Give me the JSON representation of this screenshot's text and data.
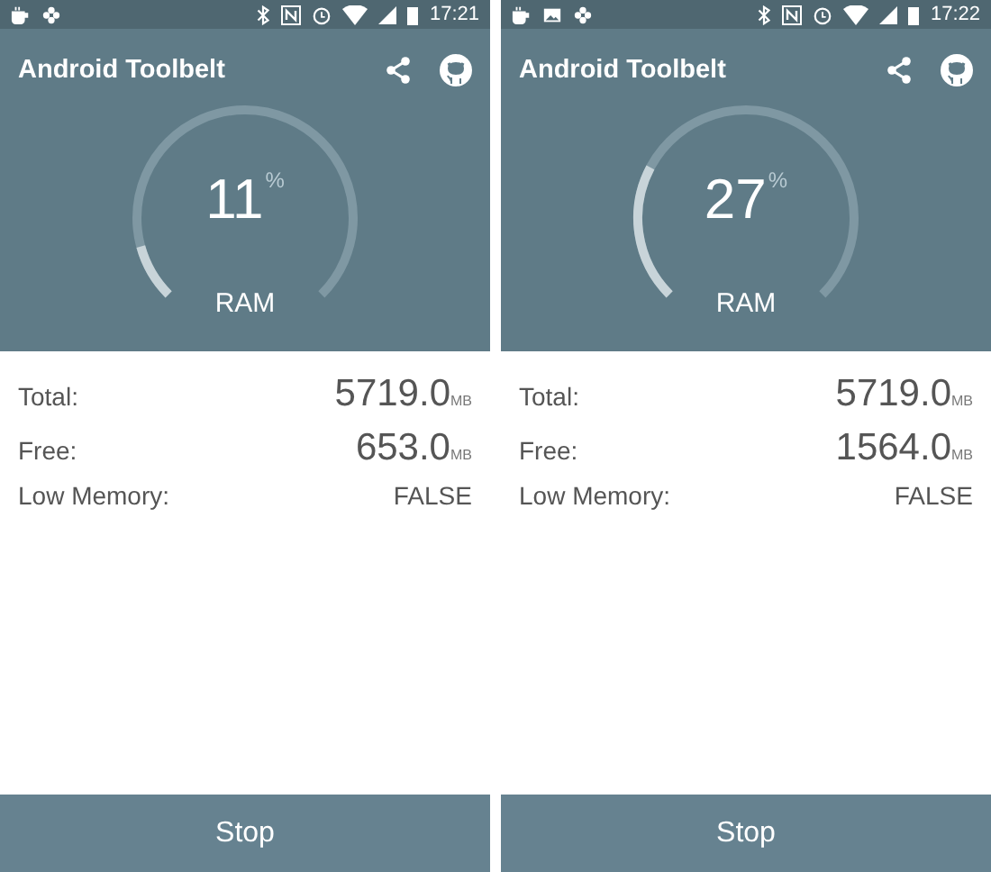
{
  "screens": [
    {
      "status_bar": {
        "notifications": [
          {
            "kind": "cup"
          },
          {
            "kind": "flower"
          }
        ],
        "time": "17:21"
      },
      "app_bar": {
        "title": "Android Toolbelt"
      },
      "gauge": {
        "value": "11",
        "unit": "%",
        "label": "RAM"
      },
      "stats": [
        {
          "label": "Total:",
          "value": "5719.0",
          "unit": "MB"
        },
        {
          "label": "Free:",
          "value": "653.0",
          "unit": "MB"
        },
        {
          "label": "Low Memory:",
          "value": "FALSE"
        }
      ],
      "button": "Stop"
    },
    {
      "status_bar": {
        "notifications": [
          {
            "kind": "cup"
          },
          {
            "kind": "image"
          },
          {
            "kind": "flower"
          }
        ],
        "time": "17:22"
      },
      "app_bar": {
        "title": "Android Toolbelt"
      },
      "gauge": {
        "value": "27",
        "unit": "%",
        "label": "RAM"
      },
      "stats": [
        {
          "label": "Total:",
          "value": "5719.0",
          "unit": "MB"
        },
        {
          "label": "Free:",
          "value": "1564.0",
          "unit": "MB"
        },
        {
          "label": "Low Memory:",
          "value": "FALSE"
        }
      ],
      "button": "Stop"
    }
  ]
}
